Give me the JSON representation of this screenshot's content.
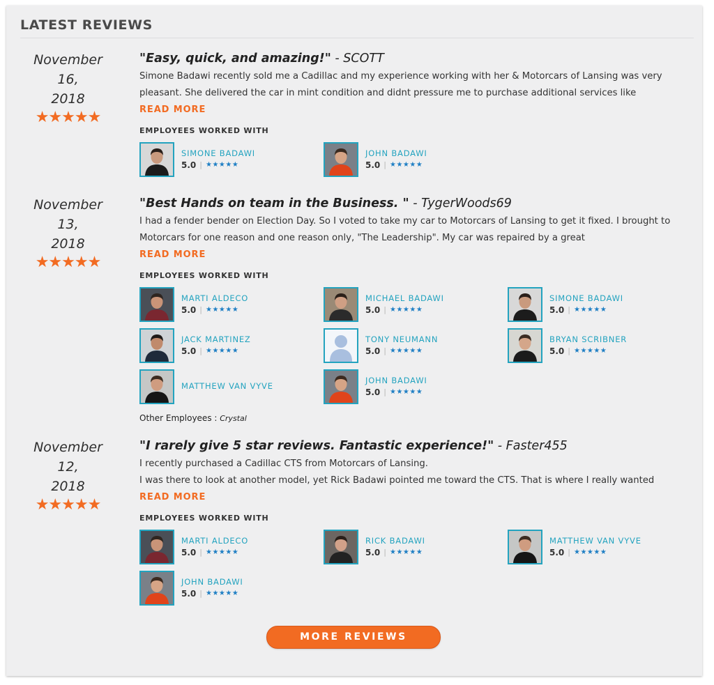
{
  "section_title": "LATEST REVIEWS",
  "employees_heading": "EMPLOYEES WORKED WITH",
  "read_more_label": "READ MORE",
  "more_reviews_label": "MORE REVIEWS",
  "colors": {
    "accent": "#f26b22",
    "link": "#23a3bf",
    "rating_star": "#1f7fc4"
  },
  "reviews": [
    {
      "date_line1": "November 16,",
      "date_line2": "2018",
      "stars": "★★★★★",
      "rating": 5,
      "quote": "\"Easy, quick, and amazing!\"",
      "author": " - SCOTT",
      "text": "Simone Badawi recently sold me a Cadillac and my experience working with her & Motorcars of Lansing was very pleasant. She delivered the car in mint condition and didnt pressure me to purchase additional services like",
      "employees": [
        {
          "name": "SIMONE BADAWI",
          "score": "5.0",
          "stars": "★★★★★",
          "photo": "simone"
        },
        {
          "name": "JOHN BADAWI",
          "score": "5.0",
          "stars": "★★★★★",
          "photo": "john"
        }
      ]
    },
    {
      "date_line1": "November 13,",
      "date_line2": "2018",
      "stars": "★★★★★",
      "rating": 5,
      "quote": "\"Best Hands on team in the Business. \"",
      "author": " - TygerWoods69",
      "text": "I had a fender bender on Election Day. So I voted to take my car to Motorcars of Lansing to get it fixed. I brought to Motorcars for one reason and one reason only, \"The Leadership\". My car was repaired by a great",
      "employees": [
        {
          "name": "MARTI ALDECO",
          "score": "5.0",
          "stars": "★★★★★",
          "photo": "marti"
        },
        {
          "name": "MICHAEL BADAWI",
          "score": "5.0",
          "stars": "★★★★★",
          "photo": "michael"
        },
        {
          "name": "SIMONE BADAWI",
          "score": "5.0",
          "stars": "★★★★★",
          "photo": "simone"
        },
        {
          "name": "JACK MARTINEZ",
          "score": "5.0",
          "stars": "★★★★★",
          "photo": "jack"
        },
        {
          "name": "TONY NEUMANN",
          "score": "5.0",
          "stars": "★★★★★",
          "photo": "placeholder"
        },
        {
          "name": "BRYAN SCRIBNER",
          "score": "5.0",
          "stars": "★★★★★",
          "photo": "bryan"
        },
        {
          "name": "MATTHEW VAN VYVE",
          "score": "",
          "stars": "",
          "photo": "matthew"
        },
        {
          "name": "JOHN BADAWI",
          "score": "5.0",
          "stars": "★★★★★",
          "photo": "john"
        }
      ],
      "other_label": "Other Employees : ",
      "other_names": "Crystal"
    },
    {
      "date_line1": "November 12,",
      "date_line2": "2018",
      "stars": "★★★★★",
      "rating": 5,
      "quote": "\"I rarely give 5 star reviews. Fantastic experience!\"",
      "author": " - Faster455",
      "text": "I recently purchased a Cadillac CTS from Motorcars of Lansing.\nI was there to look at another model, yet Rick Badawi pointed me toward the CTS. That is where I really wanted",
      "employees": [
        {
          "name": "MARTI ALDECO",
          "score": "5.0",
          "stars": "★★★★★",
          "photo": "marti"
        },
        {
          "name": "RICK BADAWI",
          "score": "5.0",
          "stars": "★★★★★",
          "photo": "rick"
        },
        {
          "name": "MATTHEW VAN VYVE",
          "score": "5.0",
          "stars": "★★★★★",
          "photo": "matthew"
        },
        {
          "name": "JOHN BADAWI",
          "score": "5.0",
          "stars": "★★★★★",
          "photo": "john"
        }
      ]
    }
  ]
}
